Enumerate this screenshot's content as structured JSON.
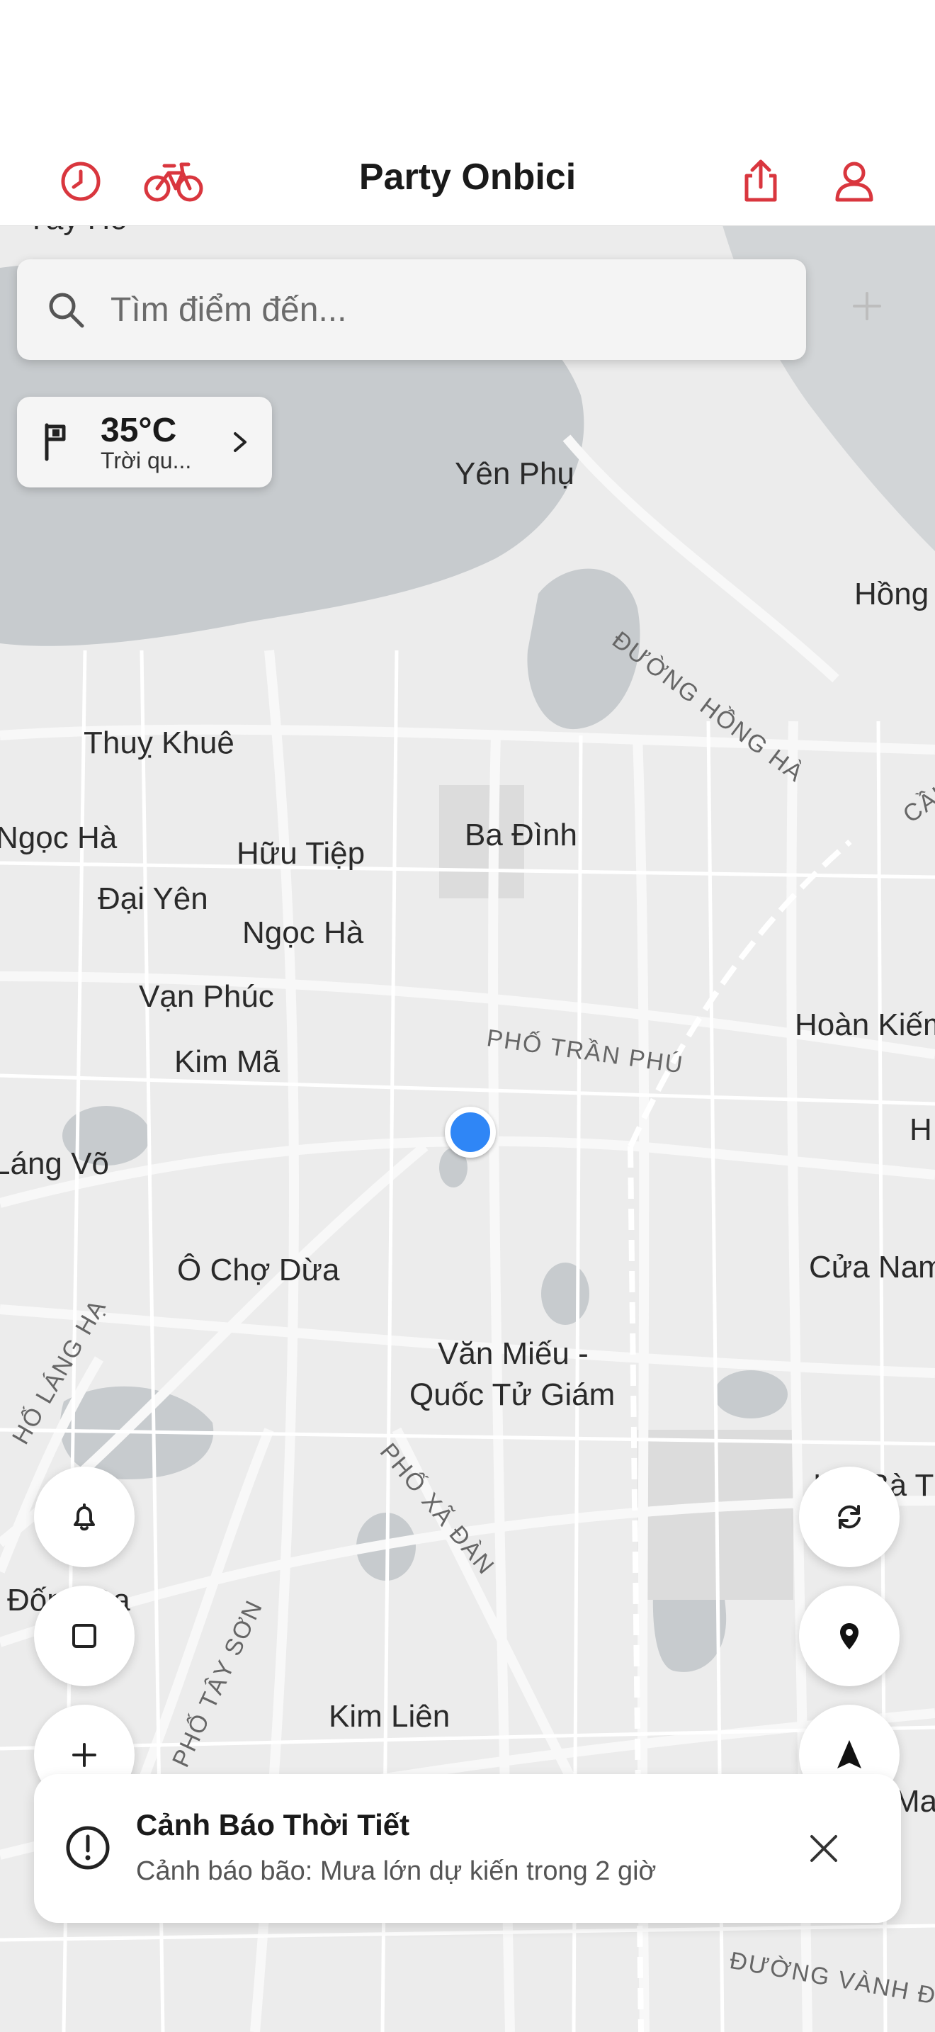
{
  "header": {
    "title": "Party Onbici",
    "left_icons": [
      "history-icon",
      "bicycle-icon"
    ],
    "right_icons": [
      "share-icon",
      "profile-icon"
    ],
    "accent": "#d9363e"
  },
  "search": {
    "placeholder": "Tìm điểm đến...",
    "add_icon": "plus-icon"
  },
  "weather": {
    "temperature": "35°C",
    "condition": "Trời qu..."
  },
  "map": {
    "places": [
      "Tây Hồ",
      "Yên Phụ",
      "Hồng",
      "Thuỵ Khuê",
      "Ngọc Hà",
      "Hữu Tiệp",
      "Ba Đình",
      "Đại Yên",
      "Ngọc Hà",
      "Vạn Phúc",
      "Kim Mã",
      "Hoàn Kiếm",
      "Láng Võ",
      "H",
      "Ô Chợ Dừa",
      "Cửa Nam",
      "Văn Miếu -",
      "Quốc Tử Giám",
      "Hai Bà T",
      "Đống Đa",
      "Kim Liên",
      "Ma"
    ],
    "roads": [
      "ĐƯỜNG HỒNG HÀ",
      "PHỐ TRẦN PHÚ",
      "PHỐ XÃ ĐÀN",
      "PHỐ TÂY SƠN",
      "HỐ LÁNG HẠ",
      "ĐƯỜNG VÀNH ĐA",
      "CẦU"
    ]
  },
  "controls": {
    "left": [
      "bell-icon",
      "square-icon",
      "plus-icon"
    ],
    "right": [
      "refresh-icon",
      "location-pin-icon",
      "navigation-arrow-icon"
    ]
  },
  "alert": {
    "title": "Cảnh Báo Thời Tiết",
    "message": "Cảnh báo bão: Mưa lớn dự kiến trong 2 giờ",
    "close_icon": "close-icon"
  }
}
